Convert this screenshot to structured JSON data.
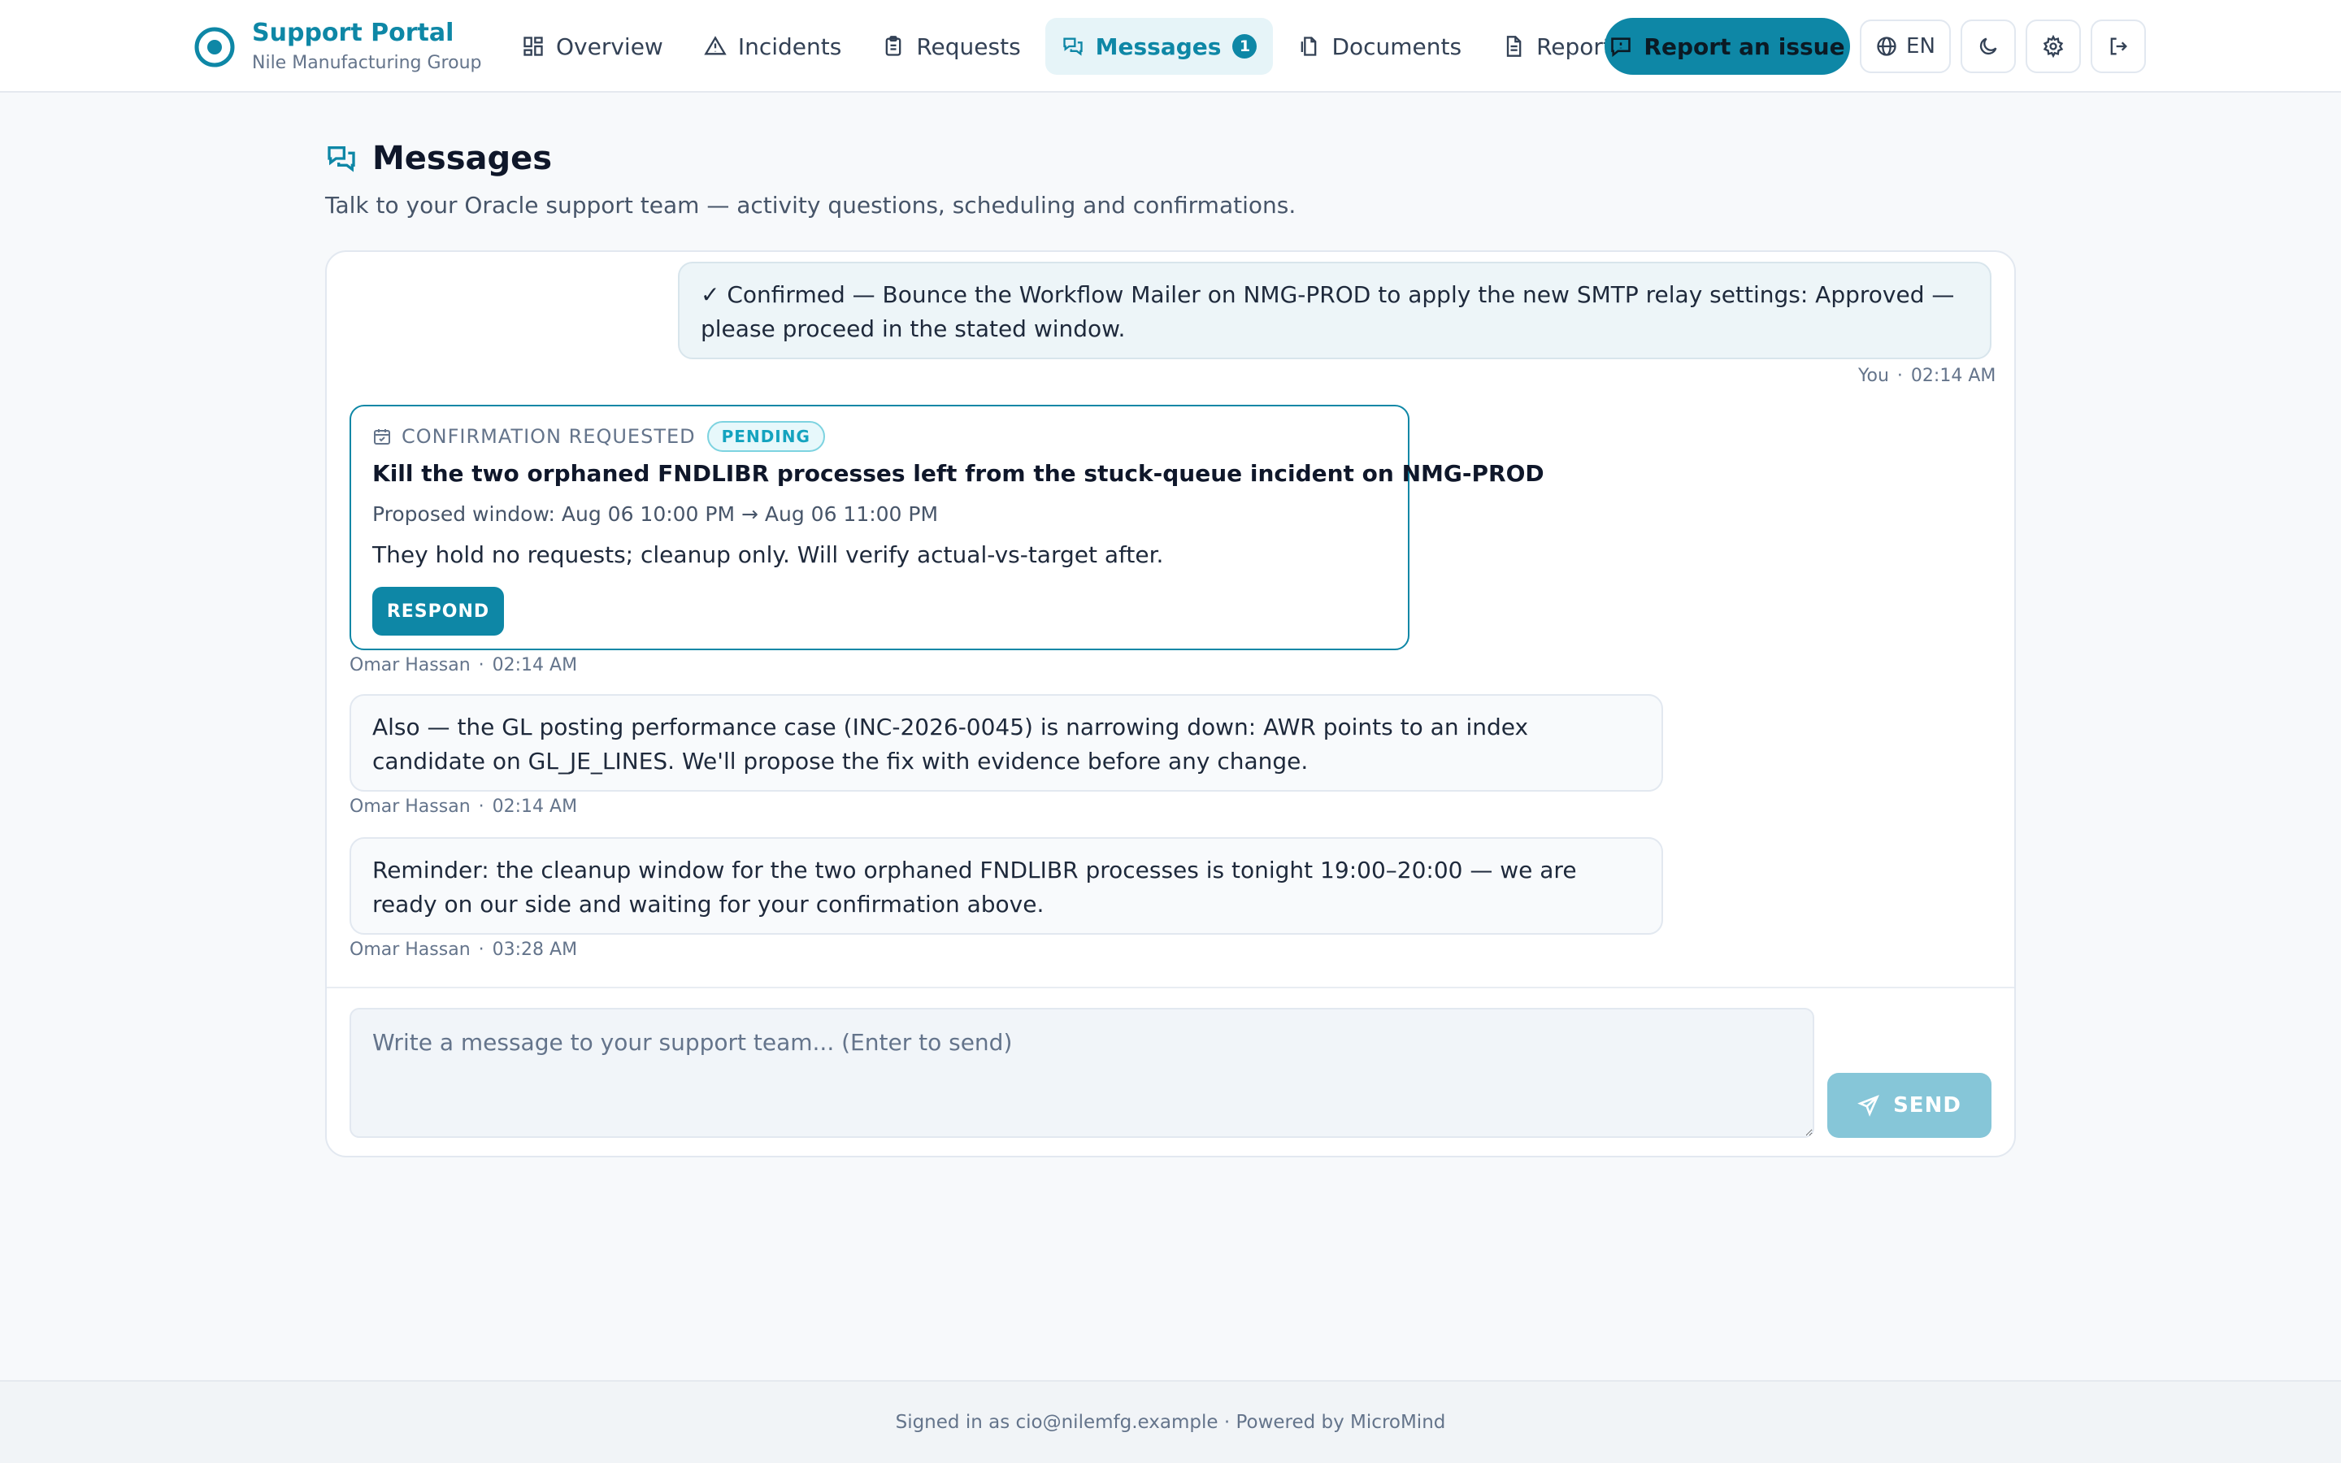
{
  "brand": {
    "name": "Support Portal",
    "org": "Nile Manufacturing Group",
    "icon": "target-logo-icon",
    "color": "#0e87a6"
  },
  "nav": {
    "items": [
      {
        "label": "Overview",
        "icon": "grid-icon"
      },
      {
        "label": "Incidents",
        "icon": "warning-triangle-icon"
      },
      {
        "label": "Requests",
        "icon": "clipboard-icon"
      },
      {
        "label": "Messages",
        "icon": "chat-bubbles-icon",
        "badge": "1",
        "active": true
      },
      {
        "label": "Documents",
        "icon": "documents-icon"
      },
      {
        "label": "Reports",
        "icon": "report-file-icon"
      }
    ],
    "report_button": "Report an issue",
    "language": "EN"
  },
  "page": {
    "title": "Messages",
    "subtitle": "Talk to your Oracle support team — activity questions, scheduling and confirmations."
  },
  "messages": [
    {
      "direction": "outgoing",
      "text": "✓ Confirmed — Bounce the Workflow Mailer on NMG-PROD to apply the new SMTP relay settings: Approved — please proceed in the stated window.",
      "author": "You",
      "time": "02:14 AM"
    },
    {
      "direction": "incoming",
      "type": "confirmation",
      "label": "CONFIRMATION REQUESTED",
      "status": "PENDING",
      "title": "Kill the two orphaned FNDLIBR processes left from the stuck-queue incident on NMG-PROD",
      "window": "Proposed window: Aug 06 10:00 PM → Aug 06 11:00 PM",
      "body": "They hold no requests; cleanup only. Will verify actual-vs-target after.",
      "action": "RESPOND",
      "author": "Omar Hassan",
      "time": "02:14 AM"
    },
    {
      "direction": "incoming",
      "text": "Also — the GL posting performance case (INC-2026-0045) is narrowing down: AWR points to an index candidate on GL_JE_LINES. We'll propose the fix with evidence before any change.",
      "author": "Omar Hassan",
      "time": "02:14 AM"
    },
    {
      "direction": "incoming",
      "text": "Reminder: the cleanup window for the two orphaned FNDLIBR processes is tonight 19:00–20:00 — we are ready on our side and waiting for your confirmation above.",
      "author": "Omar Hassan",
      "time": "03:28 AM"
    }
  ],
  "composer": {
    "placeholder": "Write a message to your support team... (Enter to send)",
    "value": "",
    "send_label": "SEND"
  },
  "footer": {
    "text": "Signed in as cio@nilemfg.example · Powered by MicroMind"
  }
}
